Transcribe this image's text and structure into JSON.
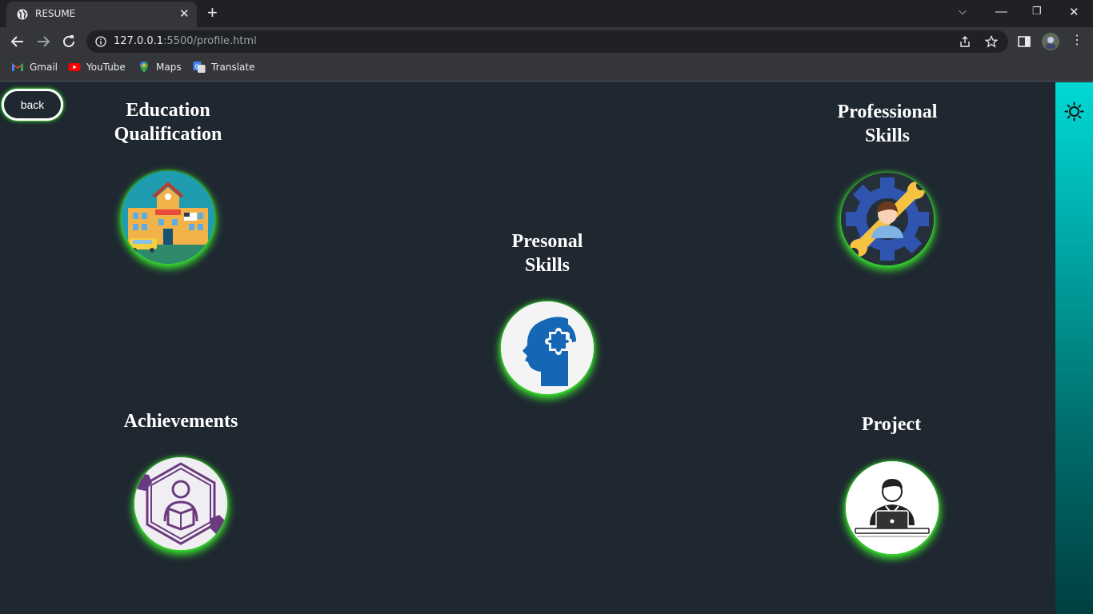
{
  "browser": {
    "tab_title": "RESUME",
    "url_host": "127.0.0.1",
    "url_path": ":5500/profile.html",
    "bookmarks": [
      {
        "label": "Gmail",
        "icon": "gmail-icon"
      },
      {
        "label": "YouTube",
        "icon": "youtube-icon"
      },
      {
        "label": "Maps",
        "icon": "maps-icon"
      },
      {
        "label": "Translate",
        "icon": "translate-icon"
      }
    ]
  },
  "page": {
    "back_label": "back",
    "sections": {
      "education": {
        "line1": "Education",
        "line2": "Qualification",
        "icon": "school-icon"
      },
      "professional": {
        "line1": "Professional",
        "line2": "Skills",
        "icon": "gear-wrench-person-icon"
      },
      "personal": {
        "line1": "Presonal",
        "line2": "Skills",
        "icon": "head-puzzle-icon"
      },
      "achievements": {
        "line1": "Achievements",
        "icon": "hexagon-reader-icon"
      },
      "project": {
        "line1": "Project",
        "icon": "person-laptop-icon"
      }
    },
    "theme_toggle_icon": "sun-icon"
  },
  "colors": {
    "page_bg": "#1f2731",
    "glow": "#39e22c",
    "sidebar_top": "#00d9d5",
    "sidebar_bottom": "#003f40"
  }
}
